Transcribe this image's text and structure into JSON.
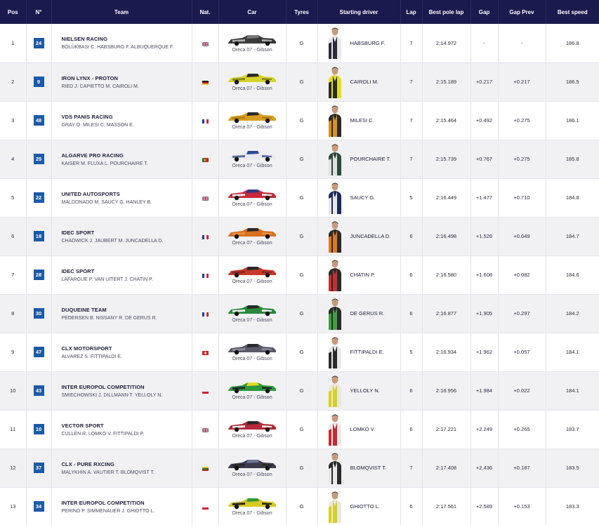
{
  "headers": {
    "pos": "Pos",
    "num": "N°",
    "team": "Team",
    "nat": "Nat.",
    "car": "Car",
    "tyres": "Tyres",
    "driver": "Starting driver",
    "lap": "Lap",
    "best": "Best pole lap",
    "gap": "Gap",
    "gap_prev": "Gap Prev",
    "speed": "Best speed"
  },
  "colors": {
    "header_bg": "#1a1a4e",
    "badge": "#1b5aa8"
  },
  "rows": [
    {
      "pos": "1",
      "num": "24",
      "team": "NIELSEN RACING",
      "drivers": "BÖLÜKBASI C. HABSBURG F. ALBUQUERQUE F.",
      "nat": "gb",
      "car": "Oreca 07 - Gibson",
      "car_colors": [
        "#3a3a3a",
        "#7a7a7a",
        "#a8a8a8"
      ],
      "tyre": "G",
      "driver": "HABSBURG F.",
      "suit": [
        "#e8e8e8",
        "#2a2a3a"
      ],
      "lap": "7",
      "best": "2:14.972",
      "gap": "-",
      "gap_prev": "-",
      "speed": "186.8"
    },
    {
      "pos": "2",
      "num": "9",
      "team": "IRON LYNX - PROTON",
      "drivers": "RIED J. CAPIETTO M. CAIROLI M.",
      "nat": "de",
      "car": "Oreca 07 - Gibson",
      "car_colors": [
        "#d4d428",
        "#2a2a2a",
        "#8a8a20"
      ],
      "tyre": "G",
      "driver": "CAIROLI M.",
      "suit": [
        "#e4e020",
        "#2a2a2a"
      ],
      "lap": "7",
      "best": "2:15.189",
      "gap": "+0.217",
      "gap_prev": "+0.217",
      "speed": "186.5"
    },
    {
      "pos": "3",
      "num": "48",
      "team": "VDS PANIS RACING",
      "drivers": "GRAY O. MILESI C. MASSON E.",
      "nat": "fr",
      "car": "Oreca 07 - Gibson",
      "car_colors": [
        "#d8a020",
        "#2a2a2a",
        "#b88018"
      ],
      "tyre": "G",
      "driver": "MILESI C.",
      "suit": [
        "#2a2a2a",
        "#d89020"
      ],
      "lap": "7",
      "best": "2:15.464",
      "gap": "+0.492",
      "gap_prev": "+0.275",
      "speed": "186.1"
    },
    {
      "pos": "4",
      "num": "25",
      "team": "ALGARVE PRO RACING",
      "drivers": "KAISER M. FLUXA L. POURCHAIRE T.",
      "nat": "pt",
      "car": "Oreca 07 - Gibson",
      "car_colors": [
        "#e8e8ee",
        "#2a4a9a",
        "#5a6a9a"
      ],
      "tyre": "G",
      "driver": "POURCHAIRE T.",
      "suit": [
        "#2a4a3a",
        "#e0e0e0"
      ],
      "lap": "7",
      "best": "2:15.739",
      "gap": "+0.767",
      "gap_prev": "+0.275",
      "speed": "185.8"
    },
    {
      "pos": "5",
      "num": "22",
      "team": "UNITED AUTOSPORTS",
      "drivers": "MALDONADO M. SAUCY G. HANLEY B.",
      "nat": "gb",
      "car": "Oreca 07 - Gibson",
      "car_colors": [
        "#c82838",
        "#2a3a8a",
        "#e8e8e8"
      ],
      "tyre": "G",
      "driver": "SAUCY G.",
      "suit": [
        "#1a2a5a",
        "#e8e8e8"
      ],
      "lap": "5",
      "best": "2:16.449",
      "gap": "+1.477",
      "gap_prev": "+0.710",
      "speed": "184.8"
    },
    {
      "pos": "6",
      "num": "18",
      "team": "IDEC SPORT",
      "drivers": "CHADWICK J. JAUBERT M. JUNCADELLA D.",
      "nat": "fr",
      "car": "Oreca 07 - Gibson",
      "car_colors": [
        "#d87020",
        "#2a2a2a",
        "#e89040"
      ],
      "tyre": "G",
      "driver": "JUNCADELLA D.",
      "suit": [
        "#2a2a2a",
        "#e07820"
      ],
      "lap": "6",
      "best": "2:16.498",
      "gap": "+1.526",
      "gap_prev": "+0.049",
      "speed": "184.7"
    },
    {
      "pos": "7",
      "num": "28",
      "team": "IDEC SPORT",
      "drivers": "LAFARGUE P. VAN UITERT J. CHATIN P.",
      "nat": "fr",
      "car": "Oreca 07 - Gibson",
      "car_colors": [
        "#c83828",
        "#2a2a2a",
        "#8a2a20"
      ],
      "tyre": "G",
      "driver": "CHATIN P.",
      "suit": [
        "#2a2a2a",
        "#c83030"
      ],
      "lap": "6",
      "best": "2:16.580",
      "gap": "+1.608",
      "gap_prev": "+0.082",
      "speed": "184.6"
    },
    {
      "pos": "8",
      "num": "30",
      "team": "DUQUEINE TEAM",
      "drivers": "PEDERSEN B. NISSANY R. DE GERUS R.",
      "nat": "fr",
      "car": "Oreca 07 - Gibson",
      "car_colors": [
        "#2a8a3a",
        "#2a2a2a",
        "#e8e8e8"
      ],
      "tyre": "G",
      "driver": "DE GERUS R.",
      "suit": [
        "#2a2a2a",
        "#40a040"
      ],
      "lap": "6",
      "best": "2:16.877",
      "gap": "+1.905",
      "gap_prev": "+0.297",
      "speed": "184.2"
    },
    {
      "pos": "9",
      "num": "47",
      "team": "CLX MOTORSPORT",
      "drivers": "ALVAREZ S. FITTIPALDI E.",
      "nat": "ch",
      "car": "Oreca 07 - Gibson",
      "car_colors": [
        "#5a5a6a",
        "#2a2a2a",
        "#8a8a9a"
      ],
      "tyre": "G",
      "driver": "FITTIPALDI E.",
      "suit": [
        "#e8e8e8",
        "#2a2a2a"
      ],
      "lap": "5",
      "best": "2:16.934",
      "gap": "+1.962",
      "gap_prev": "+0.057",
      "speed": "184.1"
    },
    {
      "pos": "10",
      "num": "43",
      "team": "INTER EUROPOL COMPETITION",
      "drivers": "SMIECHOWSKI J. DILLMANN T. YELLOLY N.",
      "nat": "pl",
      "car": "Oreca 07 - Gibson",
      "car_colors": [
        "#2a9a3a",
        "#e8d820",
        "#2a2a2a"
      ],
      "tyre": "G",
      "driver": "YELLOLY N.",
      "suit": [
        "#e8e8e0",
        "#d8d020"
      ],
      "lap": "6",
      "best": "2:16.956",
      "gap": "+1.984",
      "gap_prev": "+0.022",
      "speed": "184.1"
    },
    {
      "pos": "11",
      "num": "10",
      "team": "VECTOR SPORT",
      "drivers": "CULLEN R. LOMKO V. FITTIPALDI P.",
      "nat": "gb",
      "car": "Oreca 07 - Gibson",
      "car_colors": [
        "#b82838",
        "#2a2a2a",
        "#e8e8e8"
      ],
      "tyre": "G",
      "driver": "LOMKO V.",
      "suit": [
        "#e8e8e8",
        "#c82830"
      ],
      "lap": "6",
      "best": "2:17.221",
      "gap": "+2.249",
      "gap_prev": "+0.265",
      "speed": "183.7"
    },
    {
      "pos": "12",
      "num": "37",
      "team": "CLX - PURE RXCING",
      "drivers": "MALYKHIN A. VAUTIER T. BLOMQVIST T.",
      "nat": "lt",
      "car": "Oreca 07 - Gibson",
      "car_colors": [
        "#3a3a4a",
        "#6a7a9a",
        "#2a2a2a"
      ],
      "tyre": "G",
      "driver": "BLOMQVIST T.",
      "suit": [
        "#2a2a2a",
        "#e8e8e8"
      ],
      "lap": "7",
      "best": "2:17.408",
      "gap": "+2.436",
      "gap_prev": "+0.187",
      "speed": "183.5"
    },
    {
      "pos": "13",
      "num": "34",
      "team": "INTER EUROPOL COMPETITION",
      "drivers": "PERINO P. SIMMENAUER J. GHIOTTO L.",
      "nat": "pl",
      "car": "Oreca 07 - Gibson",
      "car_colors": [
        "#d8c820",
        "#2a9a3a",
        "#2a2a2a"
      ],
      "tyre": "G",
      "driver": "GHIOTTO L.",
      "suit": [
        "#e8e8e0",
        "#d8d020"
      ],
      "lap": "6",
      "best": "2:17.561",
      "gap": "+2.589",
      "gap_prev": "+0.153",
      "speed": "183.3"
    }
  ]
}
